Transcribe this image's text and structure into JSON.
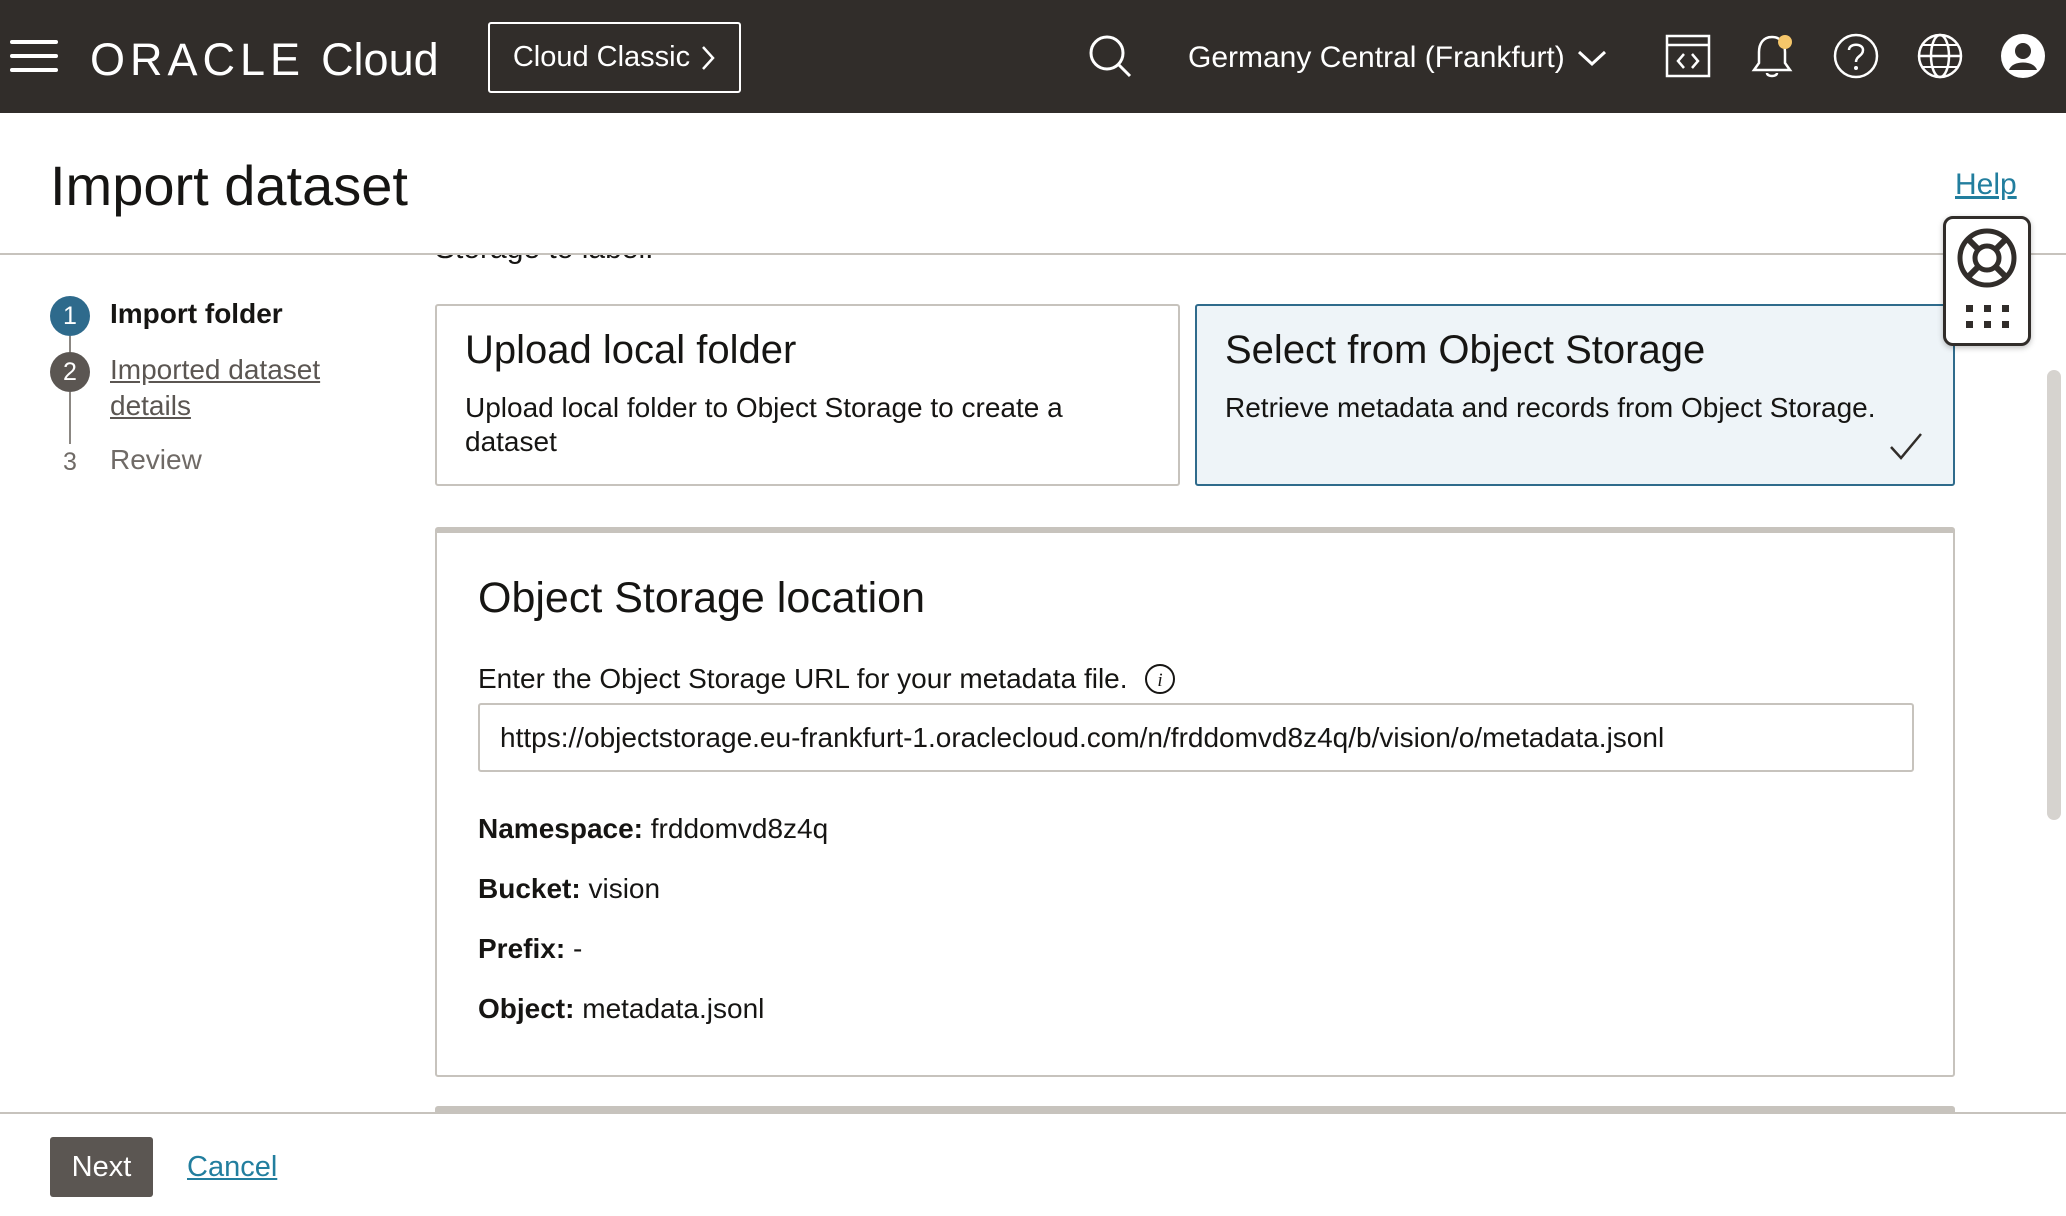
{
  "topbar": {
    "brand_oracle": "ORACLE",
    "brand_cloud": "Cloud",
    "classic_label": "Cloud Classic",
    "region": "Germany Central (Frankfurt)"
  },
  "icons": {
    "menu": "hamburger-menu-icon",
    "search": "search-icon",
    "region_dropdown": "chevron-down-icon",
    "cloud_shell": "code-console-icon",
    "notifications": "bell-icon",
    "help": "question-icon",
    "language": "globe-icon",
    "profile": "user-avatar-icon",
    "help_widget": "lifebuoy-icon",
    "apps": "grid-dots-icon",
    "info": "info-icon",
    "selected": "checkmark-icon"
  },
  "header": {
    "title": "Import dataset",
    "help_label": "Help"
  },
  "steps": [
    {
      "num": "1",
      "label": "Import folder",
      "state": "current"
    },
    {
      "num": "2",
      "label": "Imported dataset details",
      "state": "link"
    },
    {
      "num": "3",
      "label": "Review",
      "state": "upcoming"
    }
  ],
  "main": {
    "clipped_text": "Storage to label.",
    "options": [
      {
        "title": "Upload local folder",
        "description": "Upload local folder to Object Storage to create a dataset",
        "selected": false
      },
      {
        "title": "Select from Object Storage",
        "description": "Retrieve metadata and records from Object Storage.",
        "selected": true
      }
    ],
    "storage": {
      "title": "Object Storage location",
      "field_label": "Enter the Object Storage URL for your metadata file.",
      "url_value": "https://objectstorage.eu-frankfurt-1.oraclecloud.com/n/frddomvd8z4q/b/vision/o/metadata.jsonl",
      "namespace_label": "Namespace:",
      "namespace_value": "frddomvd8z4q",
      "bucket_label": "Bucket:",
      "bucket_value": "vision",
      "prefix_label": "Prefix:",
      "prefix_value": "-",
      "object_label": "Object:",
      "object_value": "metadata.jsonl"
    }
  },
  "footer": {
    "next_label": "Next",
    "cancel_label": "Cancel"
  },
  "colors": {
    "topbar_bg": "#312d2a",
    "step_current": "#2e6a8c",
    "step_done": "#5b5652",
    "link": "#227e9e",
    "selected_card_bg": "#eef4f8",
    "notification_dot": "#f5c66a"
  }
}
